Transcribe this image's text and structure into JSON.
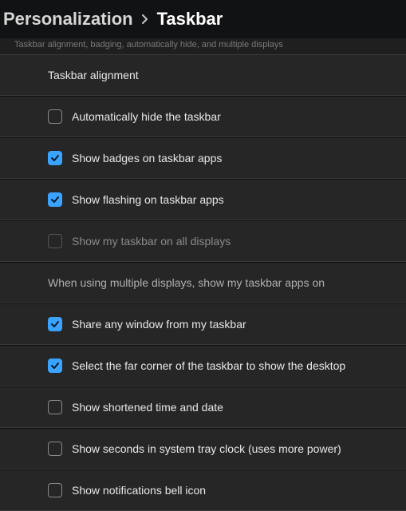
{
  "breadcrumb": {
    "parent": "Personalization",
    "current": "Taskbar"
  },
  "subheader": "Taskbar alignment, badging, automatically hide, and multiple displays",
  "rows": {
    "alignment": {
      "label": "Taskbar alignment"
    },
    "autohide": {
      "label": "Automatically hide the taskbar",
      "checked": false
    },
    "badges": {
      "label": "Show badges on taskbar apps",
      "checked": true
    },
    "flashing": {
      "label": "Show flashing on taskbar apps",
      "checked": true
    },
    "all_displays": {
      "label": "Show my taskbar on all displays",
      "checked": false,
      "disabled": true
    },
    "multi_label": {
      "label": "When using multiple displays, show my taskbar apps on"
    },
    "share_window": {
      "label": "Share any window from my taskbar",
      "checked": true
    },
    "far_corner": {
      "label": "Select the far corner of the taskbar to show the desktop",
      "checked": true
    },
    "short_time": {
      "label": "Show shortened time and date",
      "checked": false
    },
    "seconds": {
      "label": "Show seconds in system tray clock (uses more power)",
      "checked": false
    },
    "bell": {
      "label": "Show notifications bell icon",
      "checked": false
    }
  },
  "colors": {
    "accent": "#3aa3ff"
  }
}
